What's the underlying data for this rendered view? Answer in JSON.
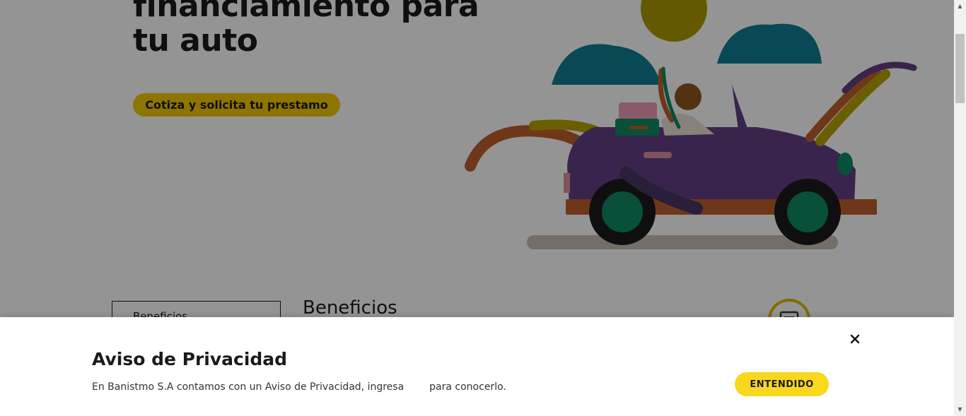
{
  "hero": {
    "title_line1": "financiamiento para",
    "title_line2": "tu auto",
    "cta_label": "Cotiza y solicita tu prestamo"
  },
  "tabs": {
    "active_label": "Beneficios"
  },
  "section": {
    "title": "Beneficios"
  },
  "icons": {
    "illustration": "car-illustration-icon",
    "chat": "chat-icon",
    "close": "close-icon"
  },
  "privacy": {
    "title": "Aviso de Privacidad",
    "text_before": "En Banistmo S.A contamos con un Aviso de Privacidad, ingresa",
    "text_after": "para conocerlo.",
    "accept_label": "ENTENDIDO"
  },
  "colors": {
    "accent_yellow": "#f9d71c",
    "car_purple": "#623f86",
    "cloud_teal": "#0f7f93",
    "sun_gold": "#ac9a00"
  },
  "scroll": {
    "up_glyph": "▲",
    "down_glyph": "▼"
  }
}
